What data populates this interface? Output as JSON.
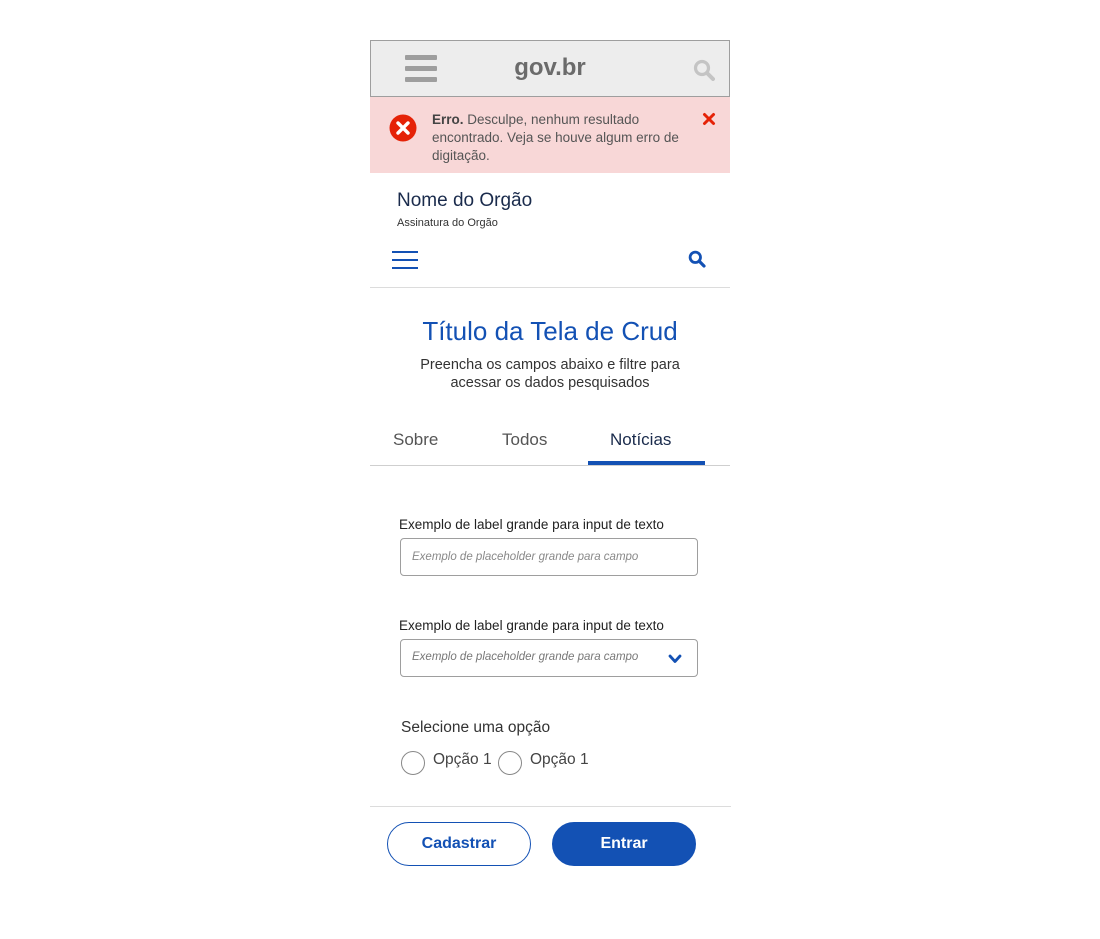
{
  "govbar": {
    "logo": "gov.br"
  },
  "alert": {
    "title": "Erro.",
    "message": " Desculpe, nenhum resultado encontrado. Veja se houve algum erro de digitação.",
    "color": "#f8d7d7"
  },
  "org": {
    "name": "Nome do Orgão",
    "subtitle": "Assinatura do Orgão"
  },
  "page": {
    "title": "Título da Tela de Crud",
    "subtitle": "Preencha os campos abaixo e filtre para acessar os dados pesquisados"
  },
  "tabs": [
    {
      "label": "Sobre",
      "active": false
    },
    {
      "label": "Todos",
      "active": false
    },
    {
      "label": "Notícias",
      "active": true
    }
  ],
  "form": {
    "text_field": {
      "label": "Exemplo de label grande para input de texto",
      "placeholder": "Exemplo de placeholder grande para campo"
    },
    "select_field": {
      "label": "Exemplo de label grande para input de texto",
      "placeholder": "Exemplo de placeholder grande para campo"
    },
    "radio_group": {
      "label": "Selecione uma opção",
      "options": [
        "Opção 1",
        "Opção 1"
      ]
    }
  },
  "actions": {
    "secondary": "Cadastrar",
    "primary": "Entrar"
  },
  "colors": {
    "accent": "#1351b4",
    "navy": "#1a2b4c",
    "error": "#e52207"
  },
  "icons": [
    "menu-icon",
    "search-icon",
    "error-circle-icon",
    "close-icon",
    "hamburger-icon",
    "chevron-down-icon"
  ]
}
